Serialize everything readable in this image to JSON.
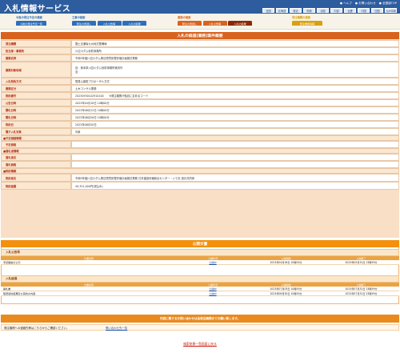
{
  "header": {
    "title": "入札情報サービス",
    "links": [
      "ヘルプ",
      "お問い合わせ",
      "全国版TOP"
    ],
    "regions": [
      "全国",
      "北海道",
      "東北",
      "関東",
      "北陸",
      "中部",
      "近畿",
      "中国",
      "四国",
      "九州沖縄"
    ]
  },
  "groups": [
    {
      "title": "今後の発注予定の検索",
      "color": "#2e6fbb",
      "tabs": [
        {
          "label": "今後の発注予定一覧",
          "active": false
        }
      ]
    },
    {
      "title": "工事の検索",
      "color": "#2e6fbb",
      "tabs": [
        {
          "label": "発注の見通し",
          "active": false
        },
        {
          "label": "入札公告等",
          "active": false
        },
        {
          "label": "入札の結果",
          "active": false
        }
      ]
    },
    {
      "title": "業務の検索",
      "color": "#d8631f",
      "tabs": [
        {
          "label": "発注の見通し",
          "active": false
        },
        {
          "label": "入札公告等",
          "active": false
        },
        {
          "label": "入札の結果",
          "active": true
        }
      ]
    },
    {
      "title": "発注機関の検索",
      "color": "#d9a10f",
      "tabs": [
        {
          "label": "発注機関情報",
          "active": false
        }
      ]
    }
  ],
  "detail": {
    "title": "入札の経過(業務)案件概要",
    "rows": [
      {
        "label": "発注機関",
        "value": "国土交通省九州地方整備局"
      },
      {
        "label": "担当部・事務所",
        "value": "川辺川ダム砂防事務所"
      },
      {
        "label": "業務名称",
        "value": "令和5年度川辺川ダム周辺環境影響評価計画検討業務"
      },
      {
        "label": "業務対象地域",
        "value": "自：熊本県川辺川ダム砂防事務所管内外\n至："
      },
      {
        "label": "入札契約方式",
        "value": "簡易公募型プロポーザル方式"
      },
      {
        "label": "業務区分",
        "value": "土木コンサル業務"
      },
      {
        "label": "契約番号",
        "value": "20230930102910100　　※発注機関が独自に定めるコード"
      },
      {
        "label": "公告日時",
        "value": "2023年04月18日 10時00分"
      },
      {
        "label": "開札日時",
        "value": "2023年06月15日 10時00分"
      },
      {
        "label": "開札日時",
        "value": "2023年06月26日 10時00分"
      },
      {
        "label": "契約日",
        "value": "2023年06月30日"
      },
      {
        "label": "電子入札対象",
        "value": "対象"
      }
    ],
    "section_planned": "■予定価格情報",
    "planned_rows": [
      {
        "label": "予定価格",
        "value": ""
      }
    ],
    "section_winner": "■落札者情報",
    "winner_rows": [
      {
        "label": "落札者名",
        "value": ""
      },
      {
        "label": "落札価格",
        "value": ""
      }
    ],
    "section_contract": "■契約情報",
    "contract_rows": [
      {
        "label": "契約者名",
        "value": "令和5年度川辺川ダム周辺環境影響評価計画検討業務 日本建設情報総合センター・いであ 設計共同体"
      },
      {
        "label": "契約金額",
        "value": "49,351,000円(税込み)"
      }
    ]
  },
  "docs": {
    "title": "公開文書",
    "columns": [
      "文書名称",
      "公開状況",
      "公開開始",
      "公開終了"
    ],
    "tables": [
      {
        "title": "入札公告等",
        "rows": [
          {
            "name": "手続開始の公示",
            "status": "公開中",
            "start": "2023年04月18日 10時00分",
            "end": "2023年05月31日 23時59分"
          }
        ]
      },
      {
        "title": "入札経過",
        "rows": [
          {
            "name": "開札書",
            "status": "公開中",
            "start": "2023年07月03日 10時00分",
            "end": "2023年07月31日 23時59分"
          },
          {
            "name": "随意契約結果及び契約の内容",
            "status": "公開中",
            "start": "2023年06月30日 10時00分",
            "end": "2023年07月31日 23時59分"
          }
        ]
      }
    ]
  },
  "contact": {
    "bar": "内容に関するお問い合わせは各発注機関までお願い致します。",
    "text": "発注機関への連絡先等はこちらからご確認ください。",
    "link": "問い合わせ先一覧"
  },
  "footer": {
    "return_link": "検索結果一覧画面に戻る"
  }
}
